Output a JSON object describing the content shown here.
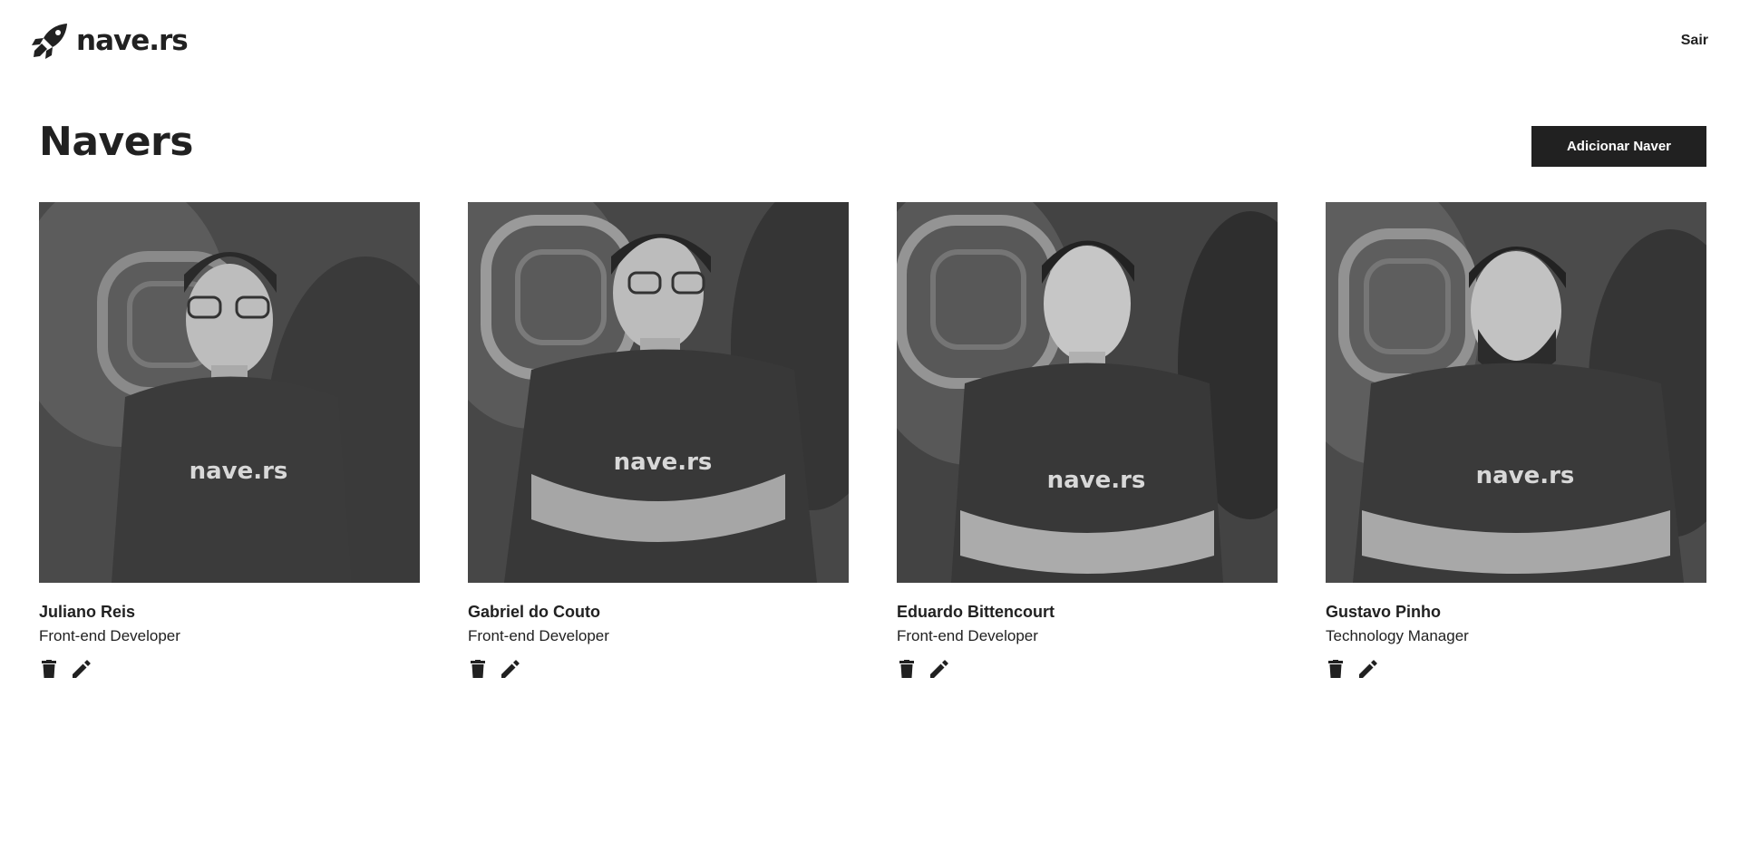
{
  "header": {
    "logo_text": "nave.rs",
    "logout_label": "Sair"
  },
  "main": {
    "title": "Navers",
    "add_button_label": "Adicionar Naver",
    "navers": [
      {
        "name": "Juliano Reis",
        "role": "Front-end Developer",
        "shirt_text": "nave.rs"
      },
      {
        "name": "Gabriel do Couto",
        "role": "Front-end Developer",
        "shirt_text": "nave.rs"
      },
      {
        "name": "Eduardo Bittencourt",
        "role": "Front-end Developer",
        "shirt_text": "nave.rs"
      },
      {
        "name": "Gustavo Pinho",
        "role": "Technology Manager",
        "shirt_text": "nave.rs"
      }
    ]
  },
  "icons": {
    "logo": "rocket-icon",
    "delete": "trash-icon",
    "edit": "pencil-icon"
  },
  "colors": {
    "primary": "#212121",
    "background": "#ffffff",
    "button_text": "#ffffff"
  }
}
